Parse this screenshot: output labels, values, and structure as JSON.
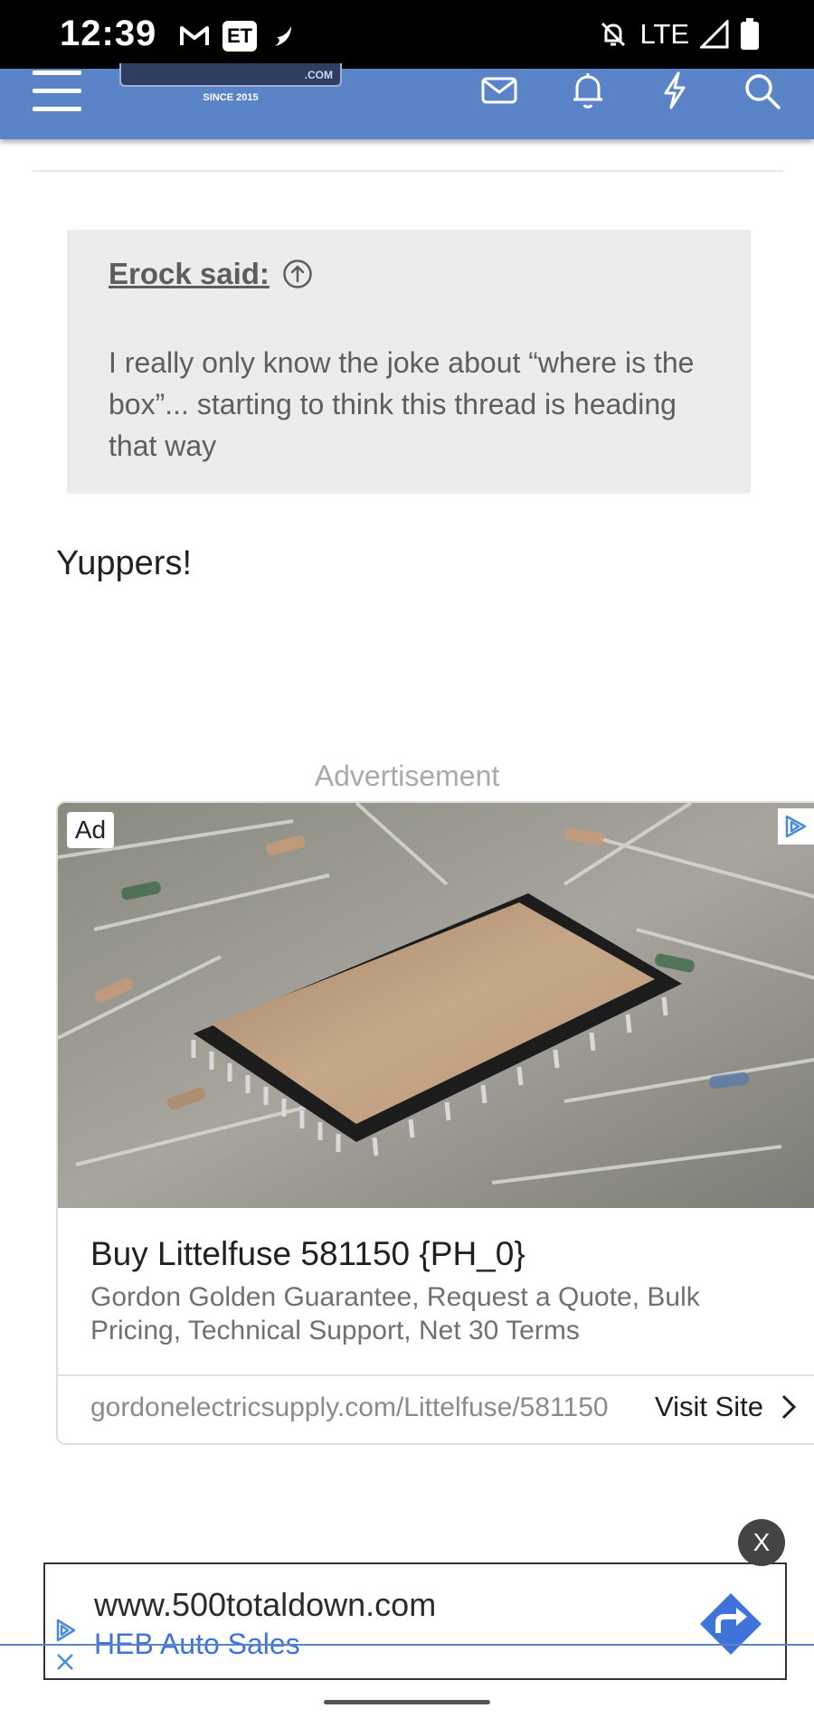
{
  "status_bar": {
    "time": "12:39",
    "left_icons": [
      "gmail-icon",
      "et-app-icon",
      "moon-app-icon"
    ],
    "et_label": "ET",
    "network": "LTE",
    "right_icons": [
      "bell-off-icon",
      "signal-icon",
      "battery-icon"
    ]
  },
  "navbar": {
    "background": "#5b83c8",
    "logo_com": ".COM",
    "logo_since": "SINCE 2015",
    "icons": [
      "menu-icon",
      "mail-icon",
      "bell-icon",
      "bolt-icon",
      "search-icon"
    ]
  },
  "post": {
    "quote_author": "Erock said:",
    "quote_text": "I really only know the joke about “where is the box”... starting to think this thread is heading that way",
    "reply": "Yuppers!"
  },
  "advertisement": {
    "label": "Advertisement",
    "badge": "Ad",
    "title": "Buy Littelfuse 581150 {PH_0}",
    "description": "Gordon Golden Guarantee, Request a Quote, Bulk Pricing, Technical Support, Net 30 Terms",
    "url": "gordonelectricsupply.com/Littelfuse/581150",
    "cta": "Visit Site"
  },
  "bottom_ad": {
    "close": "X",
    "url": "www.500totaldown.com",
    "advertiser": "HEB Auto Sales",
    "accent": "#3f73d9"
  }
}
